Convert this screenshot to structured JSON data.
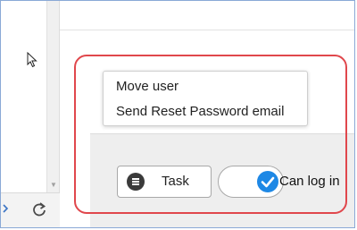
{
  "menu": {
    "items": [
      {
        "label": "Move user"
      },
      {
        "label": "Send Reset Password email"
      }
    ]
  },
  "footer": {
    "task_button": {
      "label": "Task",
      "icon": "list-circle-icon"
    },
    "login_toggle": {
      "label": "Can log in",
      "checked": true,
      "icon": "checkmark-icon"
    }
  },
  "colors": {
    "toggle_accent": "#1e88e5",
    "highlight_outline": "#e0474c"
  }
}
